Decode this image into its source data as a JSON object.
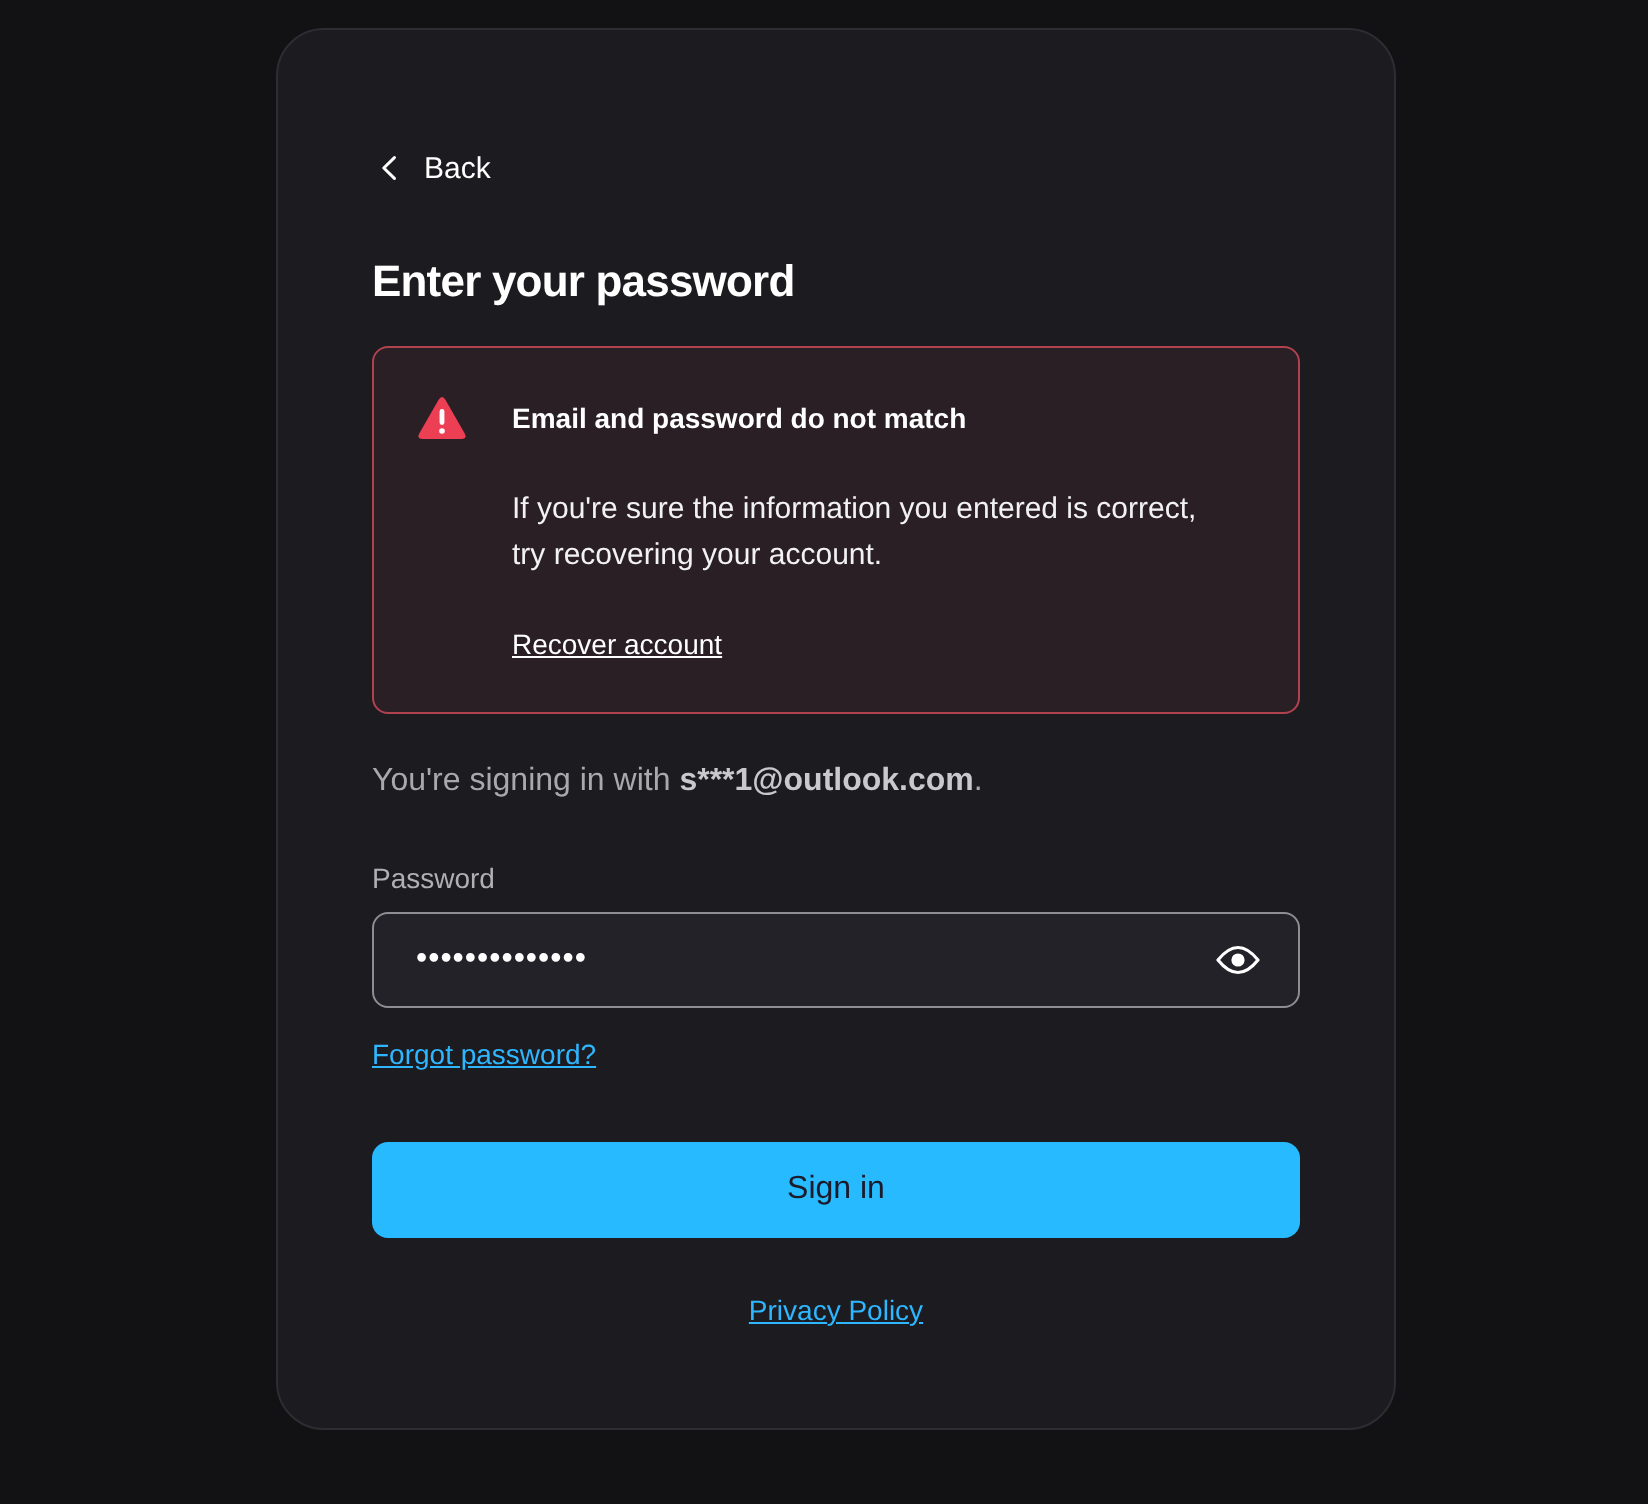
{
  "back_link": {
    "label": "Back"
  },
  "title": "Enter your password",
  "alert": {
    "kind": "error",
    "title": "Email and password do not match",
    "message": "If you're sure the information you entered is correct, try recovering your account.",
    "link": "Recover account"
  },
  "signing_in": {
    "prefix": "You're signing in with",
    "email": "s***1@outlook.com",
    "suffix": "."
  },
  "password_field": {
    "label": "Password",
    "value": "••••••••••••••"
  },
  "forgot_link": "Forgot password?",
  "sign_in_button": "Sign in",
  "privacy_link": "Privacy Policy"
}
